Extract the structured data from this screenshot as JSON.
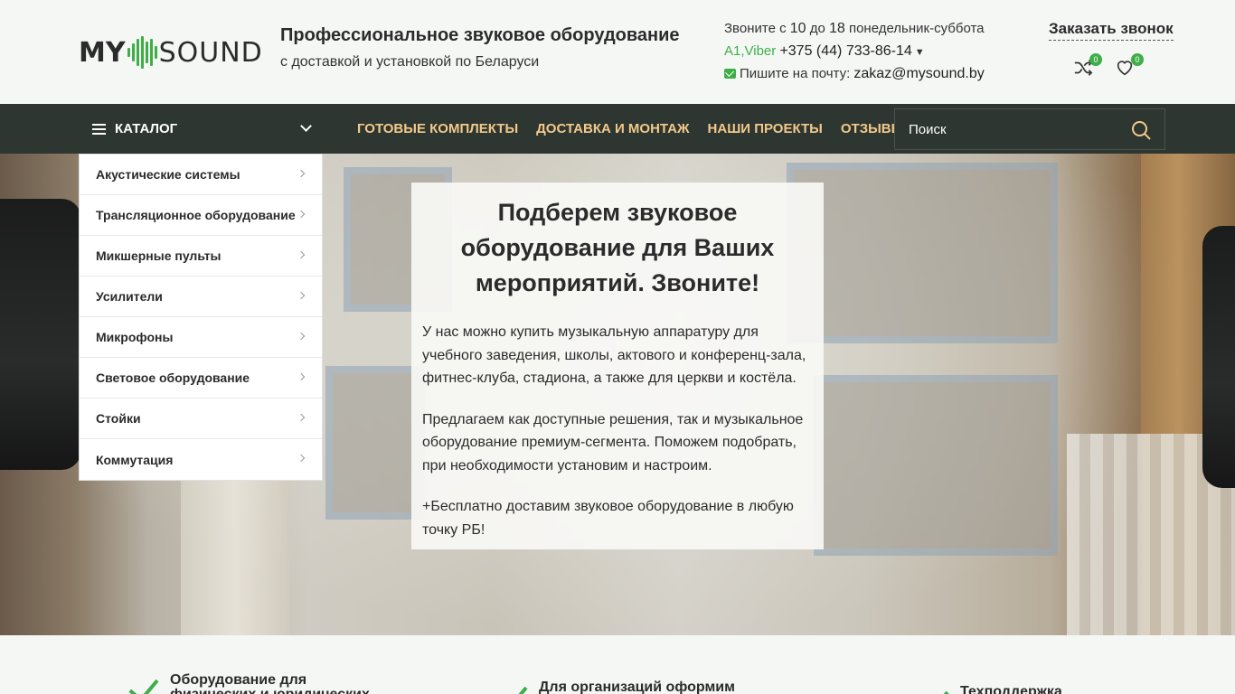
{
  "header": {
    "logo": {
      "my": "MY",
      "sound": "SOUND"
    },
    "tagline_title": "Профессиональное звуковое оборудование",
    "tagline_sub": "с доставкой и установкой по Беларуси",
    "contacts": {
      "hours_prefix": "Звоните с ",
      "hours_from": "10",
      "hours_mid": " до ",
      "hours_to": "18",
      "hours_suffix": " понедельник-суббота",
      "viber": "A1,Viber",
      "phone": "+375 (44) 733-86-14",
      "email_prefix": "Пишите на почту:",
      "email": "zakaz@mysound.by"
    },
    "callback": "Заказать звонок",
    "compare_count": "0",
    "wishlist_count": "0"
  },
  "nav": {
    "catalog_label": "КАТАЛОГ",
    "menu": [
      "ГОТОВЫЕ КОМПЛЕКТЫ",
      "ДОСТАВКА И МОНТАЖ",
      "НАШИ ПРОЕКТЫ",
      "ОТЗЫВЫ"
    ],
    "search_placeholder": "Поиск"
  },
  "catalog": [
    "Акустические системы",
    "Трансляционное оборудование",
    "Микшерные пульты",
    "Усилители",
    "Микрофоны",
    "Световое оборудование",
    "Стойки",
    "Коммутация"
  ],
  "hero": {
    "title": "Подберем звуковое оборудование для Ваших мероприятий. Звоните!",
    "p1": "У нас можно купить музыкальную аппаратуру для учебного заведения, школы, актового и конференц-зала, фитнес-клуба, стадиона, а также для церкви и костёла.",
    "p2": "Предлагаем как доступные решения, так и музыкальное оборудование премиум-сегмента. Поможем подобрать, при необходимости установим и настроим.",
    "p3": "+Бесплатно доставим звуковое оборудование в любую точку РБ!"
  },
  "features": [
    "Оборудование для физических и юридических",
    "Для организаций оформим",
    "Техподдержка"
  ],
  "colors": {
    "accent": "#3fae49",
    "nav_bg": "#2d3631",
    "nav_link": "#f3c98a"
  }
}
